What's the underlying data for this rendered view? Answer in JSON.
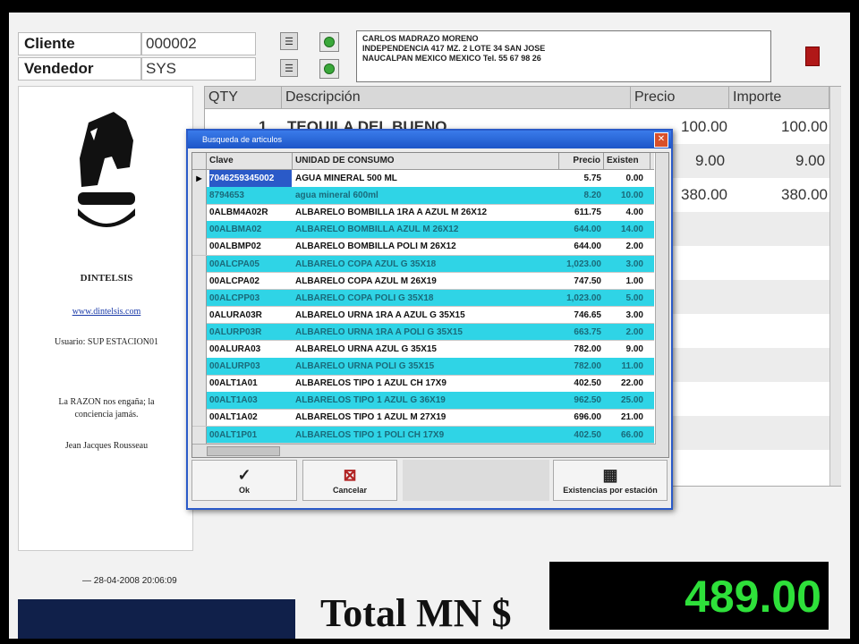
{
  "header": {
    "cliente_label": "Cliente",
    "cliente_value": "000002",
    "vendedor_label": "Vendedor",
    "vendedor_value": "SYS",
    "address_lines": [
      "CARLOS MADRAZO MORENO",
      "INDEPENDENCIA 417 MZ. 2 LOTE 34 SAN JOSE",
      "NAUCALPAN MEXICO MEXICO Tel. 55 67 98 26"
    ]
  },
  "left_panel": {
    "company": "DINTELSIS",
    "website": "www.dintelsis.com",
    "user": "Usuario: SUP ESTACION01",
    "quote": "La RAZON nos engaña; la conciencia jamás.",
    "author": "Jean Jacques Rousseau",
    "datetime": "— 28-04-2008 20:06:09"
  },
  "grid": {
    "columns": [
      "QTY",
      "Descripción",
      "Precio",
      "Importe"
    ],
    "rows": [
      {
        "qty": "1",
        "desc": "TEQUILA DEL BUENO",
        "precio": "100.00",
        "importe": "100.00"
      },
      {
        "qty": "",
        "desc": "",
        "precio": "9.00",
        "importe": "9.00"
      },
      {
        "qty": "",
        "desc": "",
        "precio": "380.00",
        "importe": "380.00"
      }
    ]
  },
  "dialog": {
    "title": "Busqueda de articulos",
    "close": "✕",
    "columns": [
      "Clave",
      "UNIDAD DE CONSUMO",
      "Precio",
      "Existen"
    ],
    "rows": [
      {
        "clave": "7046259345002",
        "desc": "AGUA MINERAL 500 ML",
        "precio": "5.75",
        "exist": "0.00",
        "alt": false
      },
      {
        "clave": "8794653",
        "desc": "agua mineral 600ml",
        "precio": "8.20",
        "exist": "10.00",
        "alt": true
      },
      {
        "clave": "0ALBM4A02R",
        "desc": "ALBARELO BOMBILLA 1RA A AZUL M 26X12",
        "precio": "611.75",
        "exist": "4.00",
        "alt": false
      },
      {
        "clave": "00ALBMA02",
        "desc": "ALBARELO BOMBILLA AZUL M 26X12",
        "precio": "644.00",
        "exist": "14.00",
        "alt": true
      },
      {
        "clave": "00ALBMP02",
        "desc": "ALBARELO BOMBILLA POLI M 26X12",
        "precio": "644.00",
        "exist": "2.00",
        "alt": false
      },
      {
        "clave": "00ALCPA05",
        "desc": "ALBARELO COPA AZUL G 35X18",
        "precio": "1,023.00",
        "exist": "3.00",
        "alt": true
      },
      {
        "clave": "00ALCPA02",
        "desc": "ALBARELO COPA AZUL M 26X19",
        "precio": "747.50",
        "exist": "1.00",
        "alt": false
      },
      {
        "clave": "00ALCPP03",
        "desc": "ALBARELO COPA POLI G 35X18",
        "precio": "1,023.00",
        "exist": "5.00",
        "alt": true
      },
      {
        "clave": "0ALURA03R",
        "desc": "ALBARELO URNA 1RA A AZUL G 35X15",
        "precio": "746.65",
        "exist": "3.00",
        "alt": false
      },
      {
        "clave": "0ALURP03R",
        "desc": "ALBARELO URNA 1RA A POLI G 35X15",
        "precio": "663.75",
        "exist": "2.00",
        "alt": true
      },
      {
        "clave": "00ALURA03",
        "desc": "ALBARELO URNA AZUL G 35X15",
        "precio": "782.00",
        "exist": "9.00",
        "alt": false
      },
      {
        "clave": "00ALURP03",
        "desc": "ALBARELO URNA POLI G 35X15",
        "precio": "782.00",
        "exist": "11.00",
        "alt": true
      },
      {
        "clave": "00ALT1A01",
        "desc": "ALBARELOS TIPO 1 AZUL CH 17X9",
        "precio": "402.50",
        "exist": "22.00",
        "alt": false
      },
      {
        "clave": "00ALT1A03",
        "desc": "ALBARELOS TIPO 1 AZUL G 36X19",
        "precio": "962.50",
        "exist": "25.00",
        "alt": true
      },
      {
        "clave": "00ALT1A02",
        "desc": "ALBARELOS TIPO 1 AZUL M 27X19",
        "precio": "696.00",
        "exist": "21.00",
        "alt": false
      },
      {
        "clave": "00ALT1P01",
        "desc": "ALBARELOS TIPO 1 POLI CH 17X9",
        "precio": "402.50",
        "exist": "66.00",
        "alt": true
      }
    ],
    "buttons": {
      "ok": "Ok",
      "cancel": "Cancelar",
      "existencias": "Existencias por estación"
    }
  },
  "total": {
    "label": "Total MN $",
    "value": "489.00"
  },
  "colors": {
    "alt_row": "#2fd4e6",
    "total_digits": "#2ee03a",
    "dialog_title": "#1d56c8"
  }
}
